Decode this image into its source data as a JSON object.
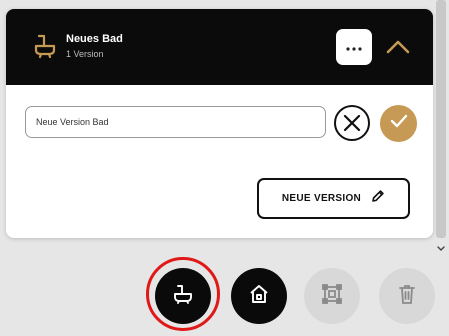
{
  "header": {
    "title": "Neues Bad",
    "subtitle": "1 Version",
    "room_icon": "bathtub-icon",
    "more_icon": "ellipsis-icon",
    "collapse_icon": "chevron-up-icon"
  },
  "version_form": {
    "input_value": "Neue Version Bad",
    "cancel_icon": "close-circle-icon",
    "confirm_icon": "check-icon"
  },
  "actions": {
    "new_version_label": "NEUE VERSION",
    "new_version_icon": "pencil-icon"
  },
  "toolbar": {
    "room_icon": "bathtub-icon",
    "home_icon": "house-icon",
    "floorplan_icon": "floorplan-icon",
    "delete_icon": "trash-icon"
  },
  "colors": {
    "header_bg": "#0b0b0b",
    "accent": "#c69a55",
    "highlight": "#e01818",
    "disabled_button": "#d8d8d8"
  }
}
